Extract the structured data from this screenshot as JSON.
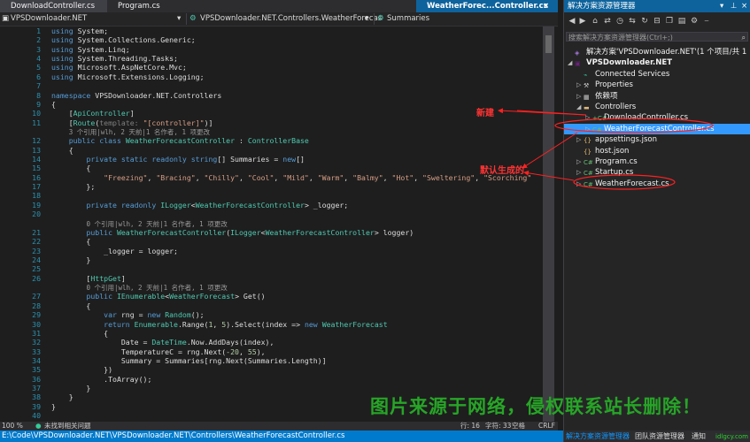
{
  "tabs": {
    "left1": "DownloadController.cs",
    "left2": "Program.cs",
    "active_right": "WeatherForec...Controller.cs",
    "close": "×"
  },
  "navbar": {
    "project": "VPSDownloader.NET",
    "class": "VPSDownloader.NET.Controllers.WeatherForecas",
    "member": "Summaries"
  },
  "code": {
    "lines": [
      {
        "n": "1",
        "html": "<span class='k'>using</span> System;"
      },
      {
        "n": "2",
        "html": "<span class='k'>using</span> System.Collections.Generic;"
      },
      {
        "n": "3",
        "html": "<span class='k'>using</span> System.Linq;"
      },
      {
        "n": "4",
        "html": "<span class='k'>using</span> System.Threading.Tasks;"
      },
      {
        "n": "5",
        "html": "<span class='k'>using</span> Microsoft.AspNetCore.Mvc;"
      },
      {
        "n": "6",
        "html": "<span class='k'>using</span> Microsoft.Extensions.Logging;"
      },
      {
        "n": "7",
        "html": ""
      },
      {
        "n": "8",
        "html": "<span class='k'>namespace</span> VPSDownloader.NET.Controllers"
      },
      {
        "n": "9",
        "html": "{"
      },
      {
        "n": "10",
        "html": "    [<span class='t'>ApiController</span>]"
      },
      {
        "n": "11",
        "html": "    [<span class='t'>Route</span>(<span class='c'>template:</span> <span class='s'>\"[controller]\"</span>)]"
      },
      {
        "n": "",
        "html": "    <span class='lens'>3 个引用|wlh, 2 天前|1 名作者, 1 项更改</span>"
      },
      {
        "n": "12",
        "html": "    <span class='k'>public class</span> <span class='t'>WeatherForecastController</span> : <span class='t'>ControllerBase</span>"
      },
      {
        "n": "13",
        "html": "    {"
      },
      {
        "n": "14",
        "html": "        <span class='k'>private static readonly string</span>[] Summaries = <span class='k'>new</span>[]"
      },
      {
        "n": "15",
        "html": "        {"
      },
      {
        "n": "16",
        "html": "            <span class='s'>\"Freezing\"</span>, <span class='s'>\"Bracing\"</span>, <span class='s'>\"Chilly\"</span>, <span class='s'>\"Cool\"</span>, <span class='s'>\"Mild\"</span>, <span class='s'>\"Warm\"</span>, <span class='s'>\"Balmy\"</span>, <span class='s'>\"Hot\"</span>, <span class='s'>\"Sweltering\"</span>, <span class='s'>\"Scorching\"</span>"
      },
      {
        "n": "17",
        "html": "        };"
      },
      {
        "n": "18",
        "html": ""
      },
      {
        "n": "19",
        "html": "        <span class='k'>private readonly</span> <span class='t'>ILogger</span>&lt;<span class='t'>WeatherForecastController</span>&gt; _logger;"
      },
      {
        "n": "20",
        "html": ""
      },
      {
        "n": "",
        "html": "        <span class='lens'>0 个引用|wlh, 2 天前|1 名作者, 1 项更改</span>"
      },
      {
        "n": "21",
        "html": "        <span class='k'>public</span> <span class='t'>WeatherForecastController</span>(<span class='t'>ILogger</span>&lt;<span class='t'>WeatherForecastController</span>&gt; logger)"
      },
      {
        "n": "22",
        "html": "        {"
      },
      {
        "n": "23",
        "html": "            _logger = logger;"
      },
      {
        "n": "24",
        "html": "        }"
      },
      {
        "n": "25",
        "html": ""
      },
      {
        "n": "26",
        "html": "        [<span class='t'>HttpGet</span>]"
      },
      {
        "n": "",
        "html": "        <span class='lens'>0 个引用|wlh, 2 天前|1 名作者, 1 项更改</span>"
      },
      {
        "n": "27",
        "html": "        <span class='k'>public</span> <span class='t'>IEnumerable</span>&lt;<span class='t'>WeatherForecast</span>&gt; Get()"
      },
      {
        "n": "28",
        "html": "        {"
      },
      {
        "n": "29",
        "html": "            <span class='k'>var</span> rng = <span class='k'>new</span> <span class='t'>Random</span>();"
      },
      {
        "n": "30",
        "html": "            <span class='k'>return</span> <span class='t'>Enumerable</span>.Range(<span class='m'>1</span>, <span class='m'>5</span>).Select(index => <span class='k'>new</span> <span class='t'>WeatherForecast</span>"
      },
      {
        "n": "31",
        "html": "            {"
      },
      {
        "n": "32",
        "html": "                Date = <span class='t'>DateTime</span>.Now.AddDays(index),"
      },
      {
        "n": "33",
        "html": "                TemperatureC = rng.Next(<span class='m'>-20</span>, <span class='m'>55</span>),"
      },
      {
        "n": "34",
        "html": "                Summary = Summaries[rng.Next(Summaries.Length)]"
      },
      {
        "n": "35",
        "html": "            })"
      },
      {
        "n": "36",
        "html": "            .ToArray();"
      },
      {
        "n": "37",
        "html": "        }"
      },
      {
        "n": "38",
        "html": "    }"
      },
      {
        "n": "39",
        "html": "}"
      },
      {
        "n": "40",
        "html": ""
      }
    ]
  },
  "status": {
    "zoom": "100 %",
    "issues": "未找到相关问题",
    "row": "行: 16",
    "col": "字符: 33",
    "mode": "空格",
    "eol": "CRLF"
  },
  "path": "E:\\Code\\VPSDownloader.NET\\VPSDownloader.NET\\Controllers\\WeatherForecastController.cs",
  "panel": {
    "title": "解决方案资源管理器",
    "search_placeholder": "搜索解决方案资源管理器(Ctrl+;)",
    "tree": [
      {
        "label": "解决方案'VPSDownloader.NET'(1 个项目/共 1",
        "level": 0,
        "tri": "",
        "icon": "sln"
      },
      {
        "label": "VPSDownloader.NET",
        "level": 0,
        "tri": "◢",
        "icon": "proj",
        "bold": true
      },
      {
        "label": "Connected Services",
        "level": 1,
        "tri": "",
        "icon": "svc"
      },
      {
        "label": "Properties",
        "level": 1,
        "tri": "▷",
        "icon": "wrench"
      },
      {
        "label": "依赖项",
        "level": 1,
        "tri": "▷",
        "icon": "dep"
      },
      {
        "label": "Controllers",
        "level": 1,
        "tri": "◢",
        "icon": "folder"
      },
      {
        "label": "DownloadController.cs",
        "level": 2,
        "tri": "▷",
        "icon": "cs",
        "prefix": "+"
      },
      {
        "label": "WeatherForecastController.cs",
        "level": 2,
        "tri": "▷",
        "icon": "cs",
        "selected": true
      },
      {
        "label": "appsettings.json",
        "level": 1,
        "tri": "▷",
        "icon": "json"
      },
      {
        "label": "host.json",
        "level": 1,
        "tri": "",
        "icon": "json"
      },
      {
        "label": "Program.cs",
        "level": 1,
        "tri": "▷",
        "icon": "cs"
      },
      {
        "label": "Startup.cs",
        "level": 1,
        "tri": "▷",
        "icon": "cs"
      },
      {
        "label": "WeatherForecast.cs",
        "level": 1,
        "tri": "▷",
        "icon": "cs"
      }
    ],
    "footer_tab1": "解决方案资源管理器",
    "footer_tab2": "团队资源管理器",
    "footer_tab3": "通知"
  },
  "annotations": {
    "new_label": "新建",
    "default_label": "默认生成的"
  },
  "watermark": "图片来源于网络，侵权联系站长删除！",
  "watermark_small": "idlgcy.com",
  "colors": {
    "accent": "#007acc",
    "annotation": "#ff2020",
    "watermark": "#27a527"
  }
}
